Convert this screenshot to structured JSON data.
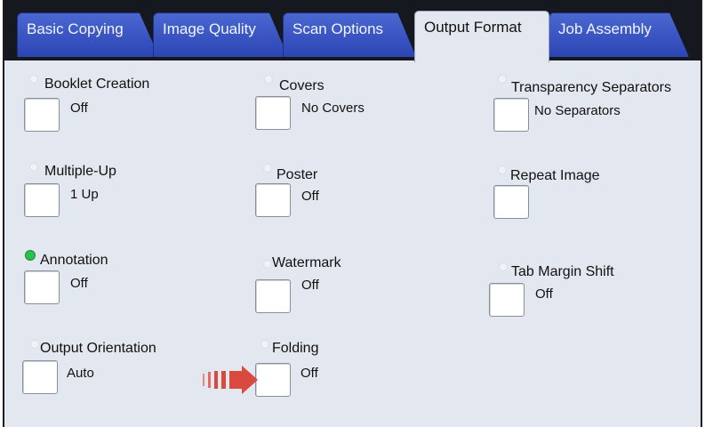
{
  "tabs": [
    {
      "label": "Basic Copying",
      "active": false
    },
    {
      "label": "Image Quality",
      "active": false
    },
    {
      "label": "Scan Options",
      "active": false
    },
    {
      "label": "Output Format",
      "active": true
    },
    {
      "label": "Job Assembly",
      "active": false
    }
  ],
  "options": {
    "booklet_creation": {
      "title": "Booklet Creation",
      "value": "Off"
    },
    "covers": {
      "title": "Covers",
      "value": "No Covers"
    },
    "transparency_separators": {
      "title": "Transparency Separators",
      "value": "No Separators"
    },
    "multiple_up": {
      "title": "Multiple-Up",
      "value": "1 Up"
    },
    "poster": {
      "title": "Poster",
      "value": "Off"
    },
    "repeat_image": {
      "title": "Repeat Image",
      "value": ""
    },
    "annotation": {
      "title": "Annotation",
      "value": "Off",
      "indicator": "green"
    },
    "watermark": {
      "title": "Watermark",
      "value": "Off"
    },
    "tab_margin_shift": {
      "title": "Tab Margin Shift",
      "value": "Off"
    },
    "output_orientation": {
      "title": "Output Orientation",
      "value": "Auto"
    },
    "folding": {
      "title": "Folding",
      "value": "Off"
    }
  },
  "colors": {
    "tab_blue": "#2c45b5",
    "panel": "#e3e7ef",
    "indicator_on": "#2dbf4f",
    "arrow": "#d9493e"
  },
  "annotation_arrow": {
    "icon": "red-arrow-icon",
    "points_to": "folding"
  }
}
